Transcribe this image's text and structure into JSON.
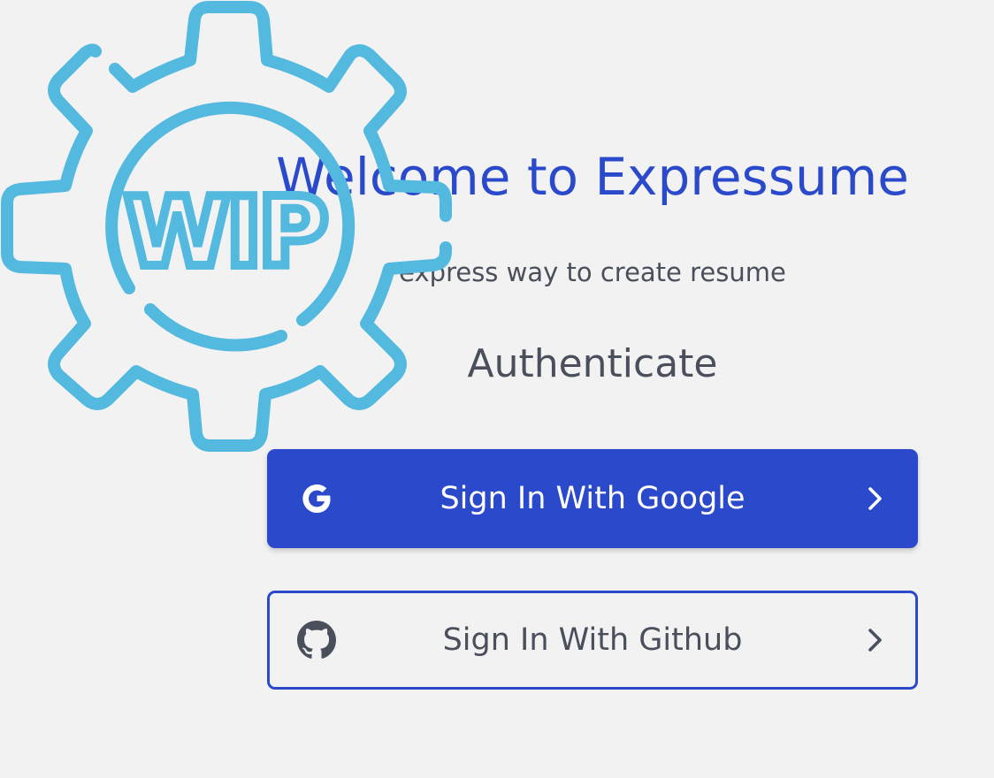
{
  "page": {
    "background": "#f2f2f2",
    "brand_color": "#2b4acb",
    "text_color": "#4a4f5c",
    "badge_color": "#53b9df"
  },
  "wip_badge": {
    "text": "WIP",
    "icon": "gear-icon"
  },
  "header": {
    "title": "Welcome to Expressume",
    "tagline": "express way to create resume"
  },
  "auth": {
    "heading": "Authenticate",
    "buttons": [
      {
        "label": "Sign In With Google",
        "icon": "google-icon",
        "trailing_icon": "chevron-right-icon",
        "style": "filled"
      },
      {
        "label": "Sign In With Github",
        "icon": "github-icon",
        "trailing_icon": "chevron-right-icon",
        "style": "outlined"
      }
    ]
  }
}
